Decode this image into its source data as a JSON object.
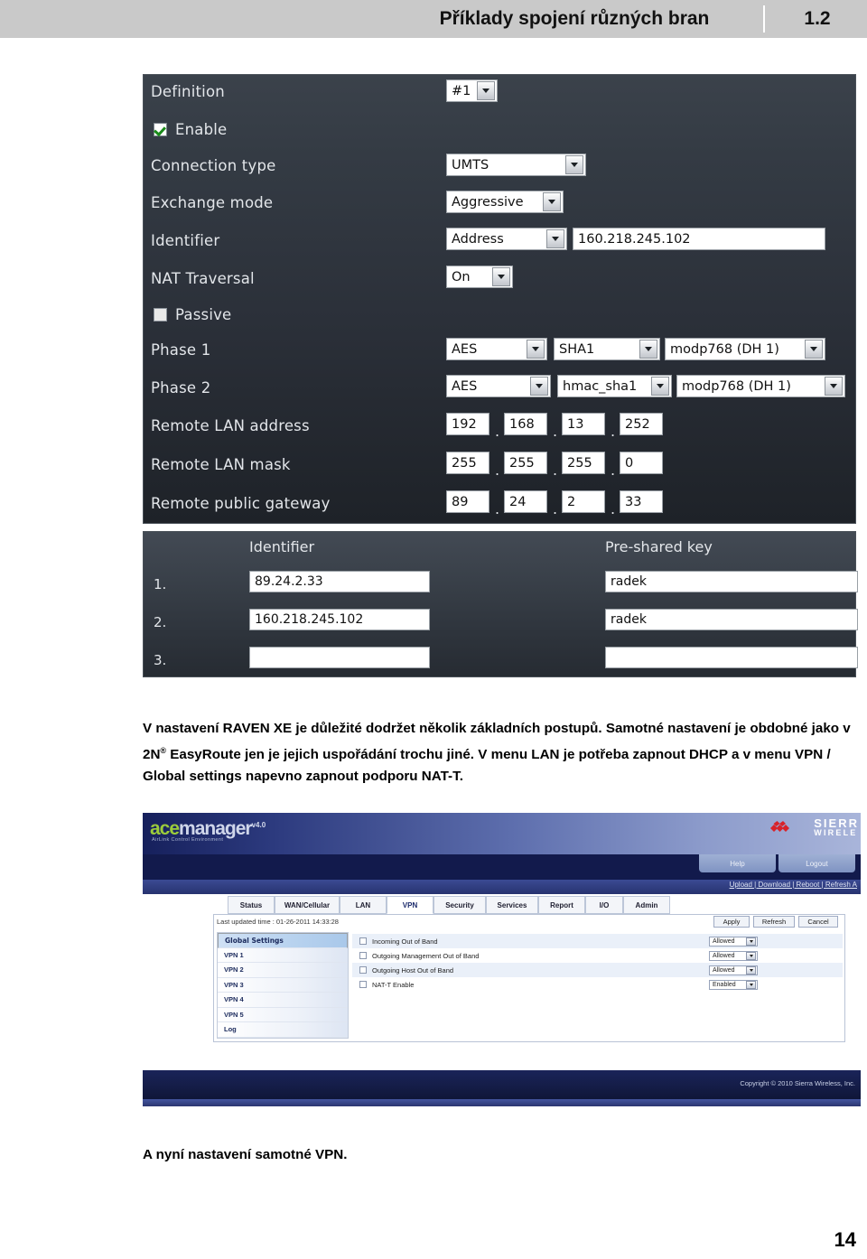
{
  "header": {
    "title": "Příklady spojení různých bran",
    "version": "1.2"
  },
  "raven_panel": {
    "rows": [
      {
        "label": "Definition"
      },
      {
        "label": "Enable"
      },
      {
        "label": "Connection type"
      },
      {
        "label": "Exchange mode"
      },
      {
        "label": "Identifier"
      },
      {
        "label": "NAT Traversal"
      },
      {
        "label": "Passive"
      },
      {
        "label": "Phase 1"
      },
      {
        "label": "Phase 2"
      },
      {
        "label": "Remote LAN address"
      },
      {
        "label": "Remote LAN mask"
      },
      {
        "label": "Remote public gateway"
      }
    ],
    "definition_value": "#1",
    "enable_label": "Enable",
    "enable_checked": true,
    "connection_type_value": "UMTS",
    "exchange_mode_value": "Aggressive",
    "identifier_type_value": "Address",
    "identifier_address_value": "160.218.245.102",
    "nat_traversal_value": "On",
    "passive_label": "Passive",
    "passive_checked": false,
    "phase1": {
      "enc": "AES",
      "auth": "SHA1",
      "dh": "modp768 (DH 1)"
    },
    "phase2": {
      "enc": "AES",
      "auth": "hmac_sha1",
      "dh": "modp768 (DH 1)"
    },
    "remote_lan_address": [
      "192",
      "168",
      "13",
      "252"
    ],
    "remote_lan_mask": [
      "255",
      "255",
      "255",
      "0"
    ],
    "remote_public_gateway": [
      "89",
      "24",
      "2",
      "33"
    ],
    "dot": "."
  },
  "psk_panel": {
    "col_identifier": "Identifier",
    "col_preshared_key": "Pre-shared key",
    "rows": [
      {
        "num": "1.",
        "identifier": "89.24.2.33",
        "key": "radek"
      },
      {
        "num": "2.",
        "identifier": "160.218.245.102",
        "key": "radek"
      },
      {
        "num": "3.",
        "identifier": "",
        "key": ""
      }
    ]
  },
  "body_text": {
    "line1_a": "V nastavení RAVEN XE je důležité dodržet několik základních postupů. Samotné nastavení je obdobné jako v 2N",
    "sup": "®",
    "line1_b": " EasyRoute jen je jejich uspořádání trochu jiné. V menu LAN je potřeba zapnout DHCP a v menu VPN / Global settings napevno zapnout podporu NAT-T."
  },
  "ace": {
    "logo_ace": "ace",
    "logo_manager": "manager",
    "logo_version": "v4.0",
    "logo_sub": "AirLink Control Environment",
    "brand_sierra": "SIERR",
    "brand_wireless": "WIRELE",
    "top_buttons": [
      "Help",
      "Logout"
    ],
    "links": "Upload | Download | Reboot | Refresh A",
    "tabs": [
      "Status",
      "WAN/Cellular",
      "LAN",
      "VPN",
      "Security",
      "Services",
      "Report",
      "I/O",
      "Admin"
    ],
    "active_tab": "VPN",
    "last_updated": "Last updated time : 01-26-2011 14:33:28",
    "action_buttons": [
      "Apply",
      "Refresh",
      "Cancel"
    ],
    "sidebar": [
      "Global Settings",
      "VPN 1",
      "VPN 2",
      "VPN 3",
      "VPN 4",
      "VPN 5",
      "Log"
    ],
    "sidebar_selected": "Global Settings",
    "settings": [
      {
        "label": "Incoming Out of Band",
        "value": "Allowed"
      },
      {
        "label": "Outgoing Management Out of Band",
        "value": "Allowed"
      },
      {
        "label": "Outgoing Host Out of Band",
        "value": "Allowed"
      },
      {
        "label": "NAT-T Enable",
        "value": "Enabled"
      }
    ],
    "copyright": "Copyright © 2010 Sierra Wireless, Inc."
  },
  "closing_text": "A nyní nastavení samotné VPN.",
  "page_number": "14",
  "colors": {
    "header_band": "#c9c9c9",
    "panel_dark": "#2e343c",
    "accent_green": "#1a8a1a",
    "ace_blue": "#16205c",
    "sierra_red": "#d8232a"
  }
}
